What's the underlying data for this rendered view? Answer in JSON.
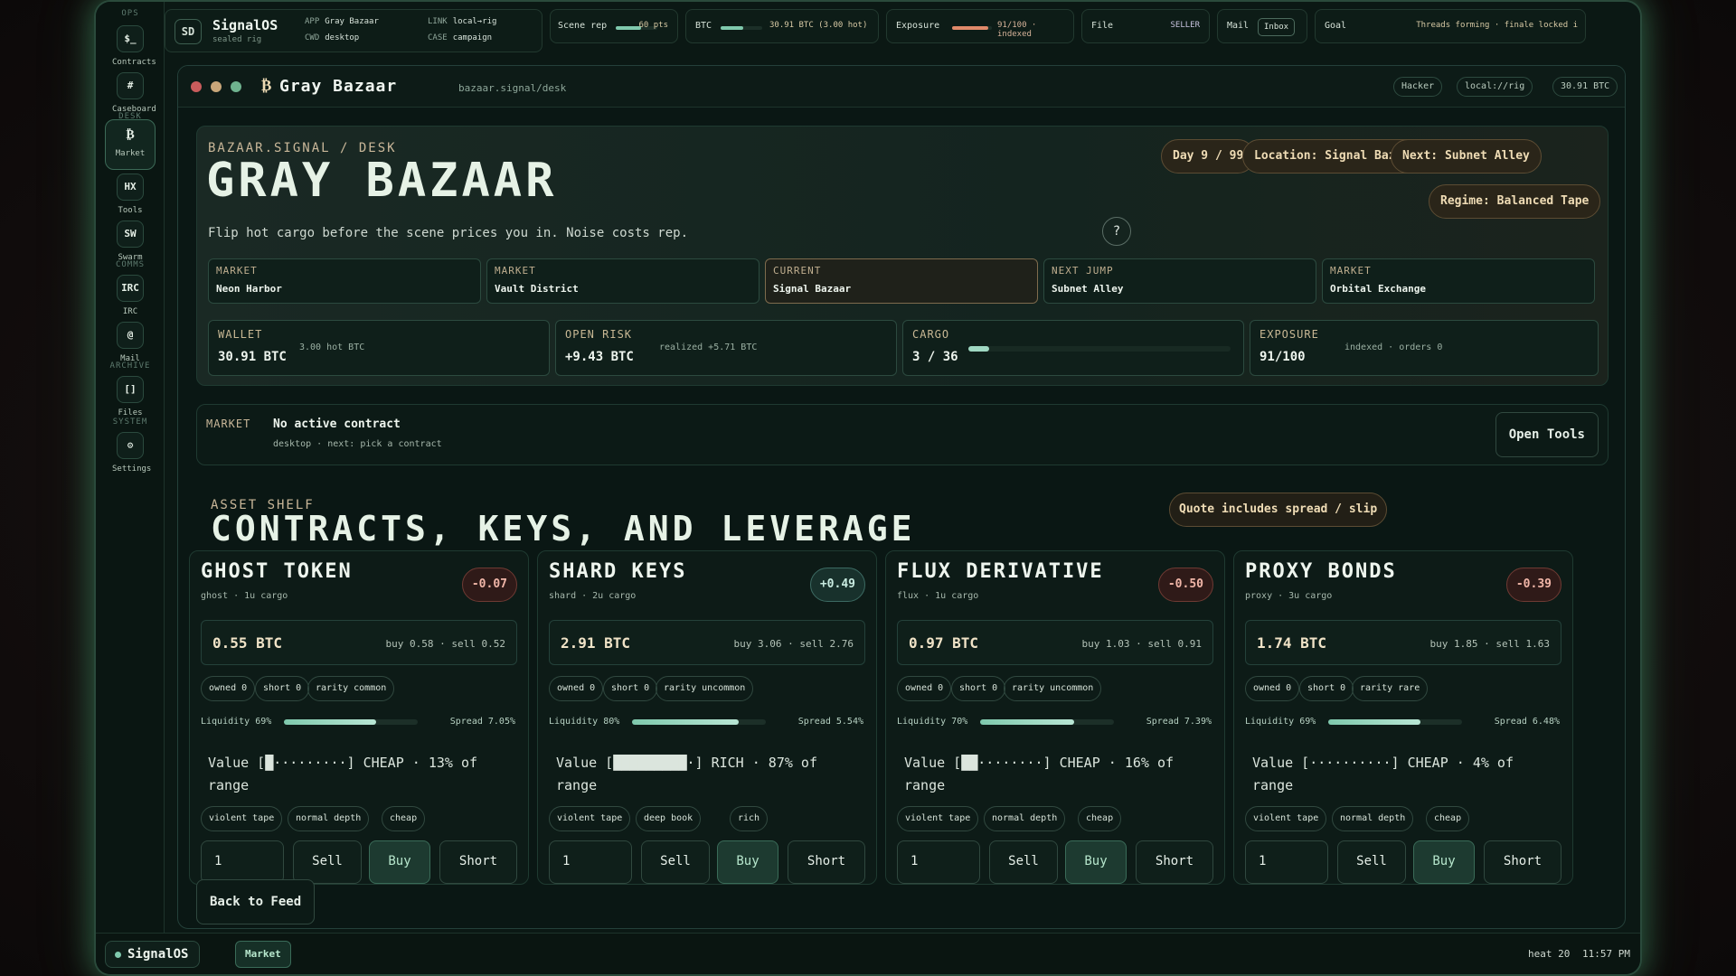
{
  "rail": {
    "groups": [
      "OPS",
      "DESK",
      "COMMS",
      "ARCHIVE",
      "SYSTEM"
    ],
    "items": [
      {
        "icon": "$_",
        "label": "Contracts"
      },
      {
        "icon": "#",
        "label": "Caseboard"
      },
      {
        "icon": "₿",
        "label": "Market"
      },
      {
        "icon": "HX",
        "label": "Tools"
      },
      {
        "icon": "SW",
        "label": "Swarm"
      },
      {
        "icon": "IRC",
        "label": "IRC"
      },
      {
        "icon": "@",
        "label": "Mail"
      },
      {
        "icon": "[]",
        "label": "Files"
      },
      {
        "icon": "⚙",
        "label": "Settings"
      }
    ]
  },
  "topbar": {
    "badge": "SD",
    "os_name": "SignalOS",
    "os_sub": "sealed rig",
    "app_key": "APP",
    "app_val": "Gray Bazaar",
    "cwd_key": "CWD",
    "cwd_val": "desktop",
    "link_key": "LINK",
    "link_val": "local→rig",
    "case_key": "CASE",
    "case_val": "campaign",
    "scene_label": "Scene rep",
    "scene_val": "60 pts",
    "scene_level": 0.6,
    "btc_label": "BTC",
    "btc_val": "30.91 BTC (3.00 hot)",
    "btc_level": 0.55,
    "exposure_label": "Exposure",
    "exposure_val": "91/100 · indexed",
    "exposure_level": 0.91,
    "file_label": "File",
    "file_val": "SELLER",
    "mail_label": "Mail",
    "mail_val": "Inbox",
    "goal_label": "Goal",
    "goal_val": "Threads forming · finale locked i"
  },
  "window": {
    "icon": "₿",
    "title": "Gray Bazaar",
    "path": "bazaar.signal/desk",
    "pills": [
      "Hacker",
      "local://rig",
      "30.91 BTC"
    ]
  },
  "hero": {
    "eyebrow": "BAZAAR.SIGNAL / DESK",
    "title": "GRAY BAZAAR",
    "subtitle": "Flip hot cargo before the scene prices you in. Noise costs rep.",
    "help": "?",
    "pills": {
      "day": "Day 9 / 99",
      "location": "Location: Signal Bazaar",
      "next": "Next: Subnet Alley",
      "regime": "Regime: Balanced Tape"
    },
    "markets": [
      {
        "kind": "MARKET",
        "name": "Neon Harbor"
      },
      {
        "kind": "MARKET",
        "name": "Vault District"
      },
      {
        "kind": "CURRENT",
        "name": "Signal Bazaar"
      },
      {
        "kind": "NEXT JUMP",
        "name": "Subnet Alley"
      },
      {
        "kind": "MARKET",
        "name": "Orbital Exchange"
      }
    ],
    "stats": {
      "wallet": {
        "label": "WALLET",
        "value": "30.91 BTC",
        "note": "3.00 hot BTC"
      },
      "risk": {
        "label": "OPEN RISK",
        "value": "+9.43 BTC",
        "note": "realized +5.71 BTC"
      },
      "cargo": {
        "label": "CARGO",
        "value": "3 / 36",
        "level": 0.083
      },
      "exposure": {
        "label": "EXPOSURE",
        "value": "91/100",
        "note": "indexed · orders 0"
      }
    }
  },
  "contract": {
    "kind": "MARKET",
    "title": "No active contract",
    "sub": "desktop · next: pick a contract",
    "button": "Open Tools"
  },
  "shelf": {
    "eyebrow": "ASSET SHELF",
    "title": "CONTRACTS, KEYS, AND LEVERAGE",
    "note": "Quote includes spread / slip",
    "cards": [
      {
        "name": "GHOST TOKEN",
        "meta": "ghost · 1u cargo",
        "delta": "-0.07",
        "delta_sign": "neg",
        "price": "0.55 BTC",
        "quote": "buy 0.58 · sell 0.52",
        "tags": [
          "owned 0",
          "short 0",
          "rarity common"
        ],
        "liquidity": "Liquidity 69%",
        "liquidity_level": 0.69,
        "spread": "Spread 7.05%",
        "value": "Value [█·········] CHEAP · 13% of range",
        "traits": [
          "violent tape",
          "normal depth",
          "cheap"
        ],
        "qty": "1",
        "sell": "Sell",
        "buy": "Buy",
        "short": "Short"
      },
      {
        "name": "SHARD KEYS",
        "meta": "shard · 2u cargo",
        "delta": "+0.49",
        "delta_sign": "pos",
        "price": "2.91 BTC",
        "quote": "buy 3.06 · sell 2.76",
        "tags": [
          "owned 0",
          "short 0",
          "rarity uncommon"
        ],
        "liquidity": "Liquidity 80%",
        "liquidity_level": 0.8,
        "spread": "Spread 5.54%",
        "value": "Value [█████████·] RICH · 87% of range",
        "traits": [
          "violent tape",
          "deep book",
          "rich"
        ],
        "qty": "1",
        "sell": "Sell",
        "buy": "Buy",
        "short": "Short"
      },
      {
        "name": "FLUX DERIVATIVE",
        "meta": "flux · 1u cargo",
        "delta": "-0.50",
        "delta_sign": "neg",
        "price": "0.97 BTC",
        "quote": "buy 1.03 · sell 0.91",
        "tags": [
          "owned 0",
          "short 0",
          "rarity uncommon"
        ],
        "liquidity": "Liquidity 70%",
        "liquidity_level": 0.7,
        "spread": "Spread 7.39%",
        "value": "Value [██········] CHEAP · 16% of range",
        "traits": [
          "violent tape",
          "normal depth",
          "cheap"
        ],
        "qty": "1",
        "sell": "Sell",
        "buy": "Buy",
        "short": "Short"
      },
      {
        "name": "PROXY BONDS",
        "meta": "proxy · 3u cargo",
        "delta": "-0.39",
        "delta_sign": "neg",
        "price": "1.74 BTC",
        "quote": "buy 1.85 · sell 1.63",
        "tags": [
          "owned 0",
          "short 0",
          "rarity rare"
        ],
        "liquidity": "Liquidity 69%",
        "liquidity_level": 0.69,
        "spread": "Spread 6.48%",
        "value": "Value [··········] CHEAP · 4% of range",
        "traits": [
          "violent tape",
          "normal depth",
          "cheap"
        ],
        "qty": "1",
        "sell": "Sell",
        "buy": "Buy",
        "short": "Short"
      }
    ]
  },
  "back_button": "Back to Feed",
  "statusbar": {
    "os_name": "SignalOS",
    "active_app": "Market",
    "heat": "heat 20",
    "time": "11:57 PM"
  },
  "colors": {
    "accent": "#7fc9ad",
    "warm": "#efdcb5",
    "negative": "#f1b6a8",
    "dot_red": "#c95c5c",
    "dot_amber": "#c9a77a",
    "dot_green": "#6fb38f"
  }
}
